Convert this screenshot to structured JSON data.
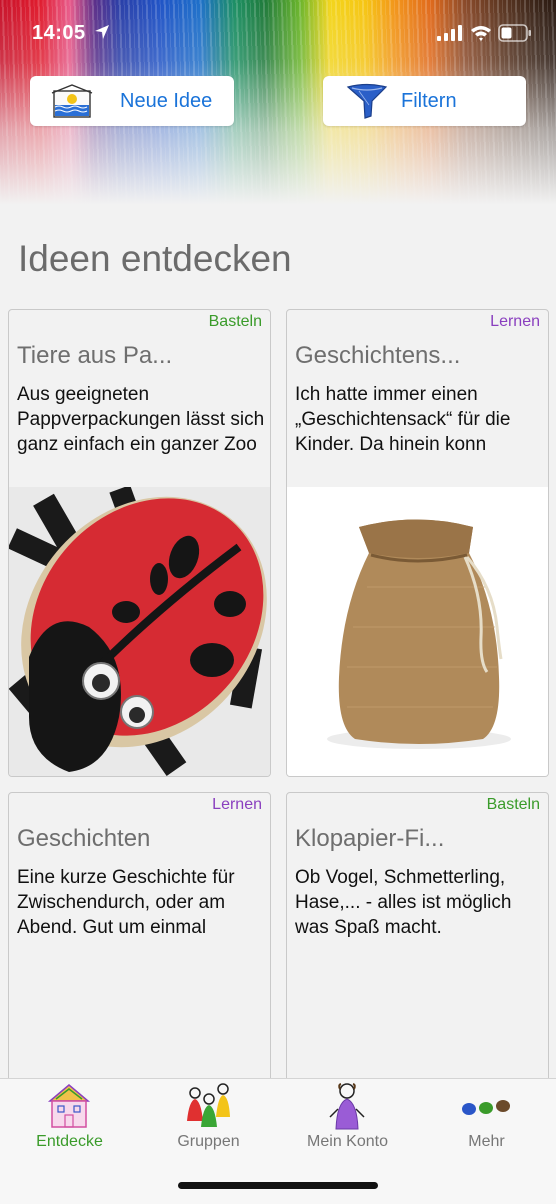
{
  "status_bar": {
    "time": "14:05"
  },
  "actions": {
    "new_idea_label": "Neue Idee",
    "filter_label": "Filtern"
  },
  "page_title": "Ideen entdecken",
  "colors": {
    "accent_blue": "#1a73d9",
    "category_basteln": "#3a9b2a",
    "category_lernen": "#8a3fbf",
    "tab_active": "#3a9b2a"
  },
  "cards": [
    {
      "category": "Basteln",
      "title": "Tiere aus Pa...",
      "description": "Aus geeigneten Pappverpackungen lässt sich ganz einfach ein ganzer Zoo",
      "image": "ladybug-craft-image"
    },
    {
      "category": "Lernen",
      "title": "Geschichtens...",
      "description": "Ich hatte immer einen „Geschichtensack“ für die Kinder. Da hinein konn",
      "image": "burlap-sack-image"
    },
    {
      "category": "Lernen",
      "title": "Geschichten",
      "description": "Eine kurze Geschichte für Zwischendurch, oder am Abend. Gut um einmal"
    },
    {
      "category": "Basteln",
      "title": "Klopapier-Fi...",
      "description": "Ob Vogel, Schmetterling, Hase,... - alles ist möglich was Spaß macht."
    }
  ],
  "tabs": [
    {
      "label": "Entdecke",
      "icon": "house-drawing-icon",
      "active": true
    },
    {
      "label": "Gruppen",
      "icon": "people-drawing-icon",
      "active": false
    },
    {
      "label": "Mein Konto",
      "icon": "person-drawing-icon",
      "active": false
    },
    {
      "label": "Mehr",
      "icon": "dots-drawing-icon",
      "active": false
    }
  ]
}
